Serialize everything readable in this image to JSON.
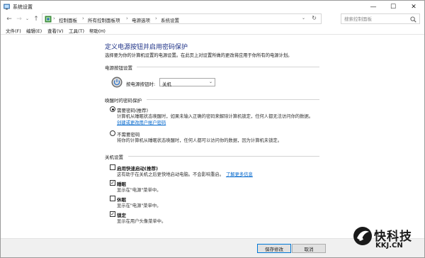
{
  "window": {
    "title": "系统设置"
  },
  "address": {
    "crumbs": [
      "控制面板",
      "所有控制面板项",
      "电源选项",
      "系统设置"
    ],
    "separator": "›"
  },
  "search": {
    "placeholder": "搜索控制面板"
  },
  "menu": [
    "文件(F)",
    "编辑(E)",
    "查看(V)",
    "工具(T)",
    "帮助(H)"
  ],
  "page": {
    "title": "定义电源按钮并启用密码保护",
    "subtitle": "选择要为你的计算机设置的电源设置。在此页上对设置所做的更改将应用于你所有的电源计划。"
  },
  "power_button_settings": {
    "heading": "电源按钮设置",
    "label": "按电源按钮时:",
    "selected": "关机"
  },
  "wake_password": {
    "heading": "唤醒时的密码保护",
    "options": [
      {
        "label": "需要密码(推荐)",
        "selected": true,
        "desc": "计算机从睡眠状态唤醒时，如果未输入正确的密码来解除计算机锁定，任何人都无法访问你的数据。",
        "link": "创建或更改用户帐户密码"
      },
      {
        "label": "不需要密码",
        "selected": false,
        "desc": "将你的计算机从睡眠状态唤醒时，任何人都可以访问你的数据，因为计算机未锁定。"
      }
    ]
  },
  "shutdown": {
    "heading": "关机设置",
    "items": [
      {
        "label": "启用快速启动(推荐)",
        "checked": false,
        "desc": "这有助于在关机之后更快地启动电脑。不会影响重启。",
        "link": "了解更多信息"
      },
      {
        "label": "睡眠",
        "checked": true,
        "desc": "显示在\"电源\"菜单中。"
      },
      {
        "label": "休眠",
        "checked": false,
        "desc": "显示在\"电源\"菜单中。"
      },
      {
        "label": "锁定",
        "checked": true,
        "desc": "显示在用户头像菜单中。"
      }
    ]
  },
  "footer": {
    "save": "保存修改",
    "cancel": "取消"
  },
  "watermark": {
    "name": "快科技",
    "url": "KKJ.CN"
  },
  "colors": {
    "title_blue": "#1e3287",
    "link_blue": "#0066cc",
    "accent": "#0078d7"
  }
}
